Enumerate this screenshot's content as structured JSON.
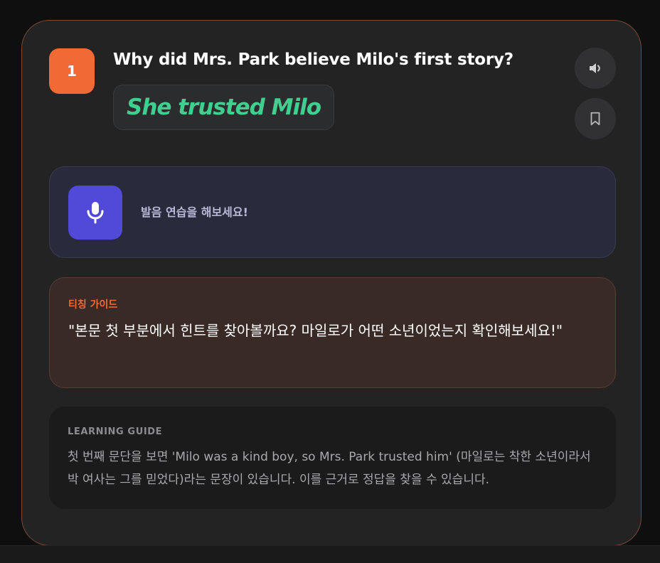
{
  "question": {
    "number": "1",
    "text": "Why did Mrs. Park believe Milo's first story?",
    "answer": "She trusted Milo"
  },
  "controls": {
    "speaker_icon": "speaker-icon",
    "bookmark_icon": "bookmark-icon"
  },
  "pronunciation": {
    "icon": "microphone-icon",
    "label": "발음 연습을 해보세요!"
  },
  "teaching_guide": {
    "title": "티칭 가이드",
    "quote": "\"본문 첫 부분에서 힌트를 찾아볼까요? 마일로가 어떤 소년이었는지 확인해보세요!\""
  },
  "learning_guide": {
    "title": "LEARNING GUIDE",
    "text": "첫 번째 문단을 보면 'Milo was a kind boy, so Mrs. Park trusted him' (마일로는 착한 소년이라서 박 여사는 그를 믿었다)라는 문장이 있습니다. 이를 근거로 정답을 찾을 수 있습니다."
  },
  "colors": {
    "accent_orange": "#f26a33",
    "answer_green": "#3fd08f",
    "mic_purple": "#5149d8"
  }
}
